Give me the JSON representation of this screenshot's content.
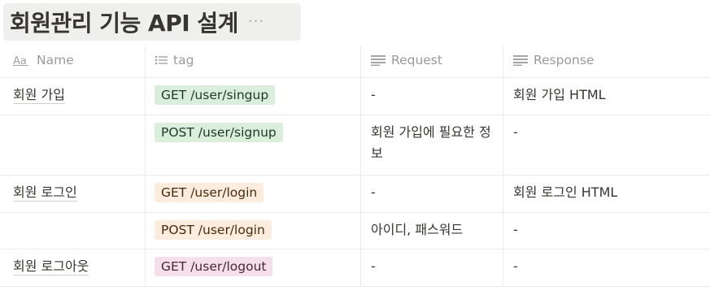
{
  "page": {
    "title": "회원관리 기능 API 설계",
    "more_label": "···"
  },
  "columns": {
    "name": "Name",
    "tag": "tag",
    "request": "Request",
    "response": "Response"
  },
  "rows": [
    {
      "name": "회원 가입",
      "tag": "GET /user/singup",
      "tag_color": "#dbeddb",
      "request": "-",
      "response": "회원 가입 HTML"
    },
    {
      "name": "",
      "tag": "POST /user/signup",
      "tag_color": "#dbeddb",
      "request": "회원 가입에 필요한 정보",
      "response": "-"
    },
    {
      "name": "회원 로그인",
      "tag": "GET /user/login",
      "tag_color": "#fbecdd",
      "request": "-",
      "response": "회원 로그인 HTML"
    },
    {
      "name": "",
      "tag": "POST /user/login",
      "tag_color": "#fbecdd",
      "request": "아이디, 패스워드",
      "response": "-"
    },
    {
      "name": "회원 로그아웃",
      "tag": "GET /user/logout",
      "tag_color": "#f5e0e9",
      "request": "-",
      "response": "-"
    }
  ],
  "icons": {
    "name": "text-aa-icon",
    "tag": "list-icon",
    "request": "text-lines-icon",
    "response": "text-lines-icon"
  }
}
